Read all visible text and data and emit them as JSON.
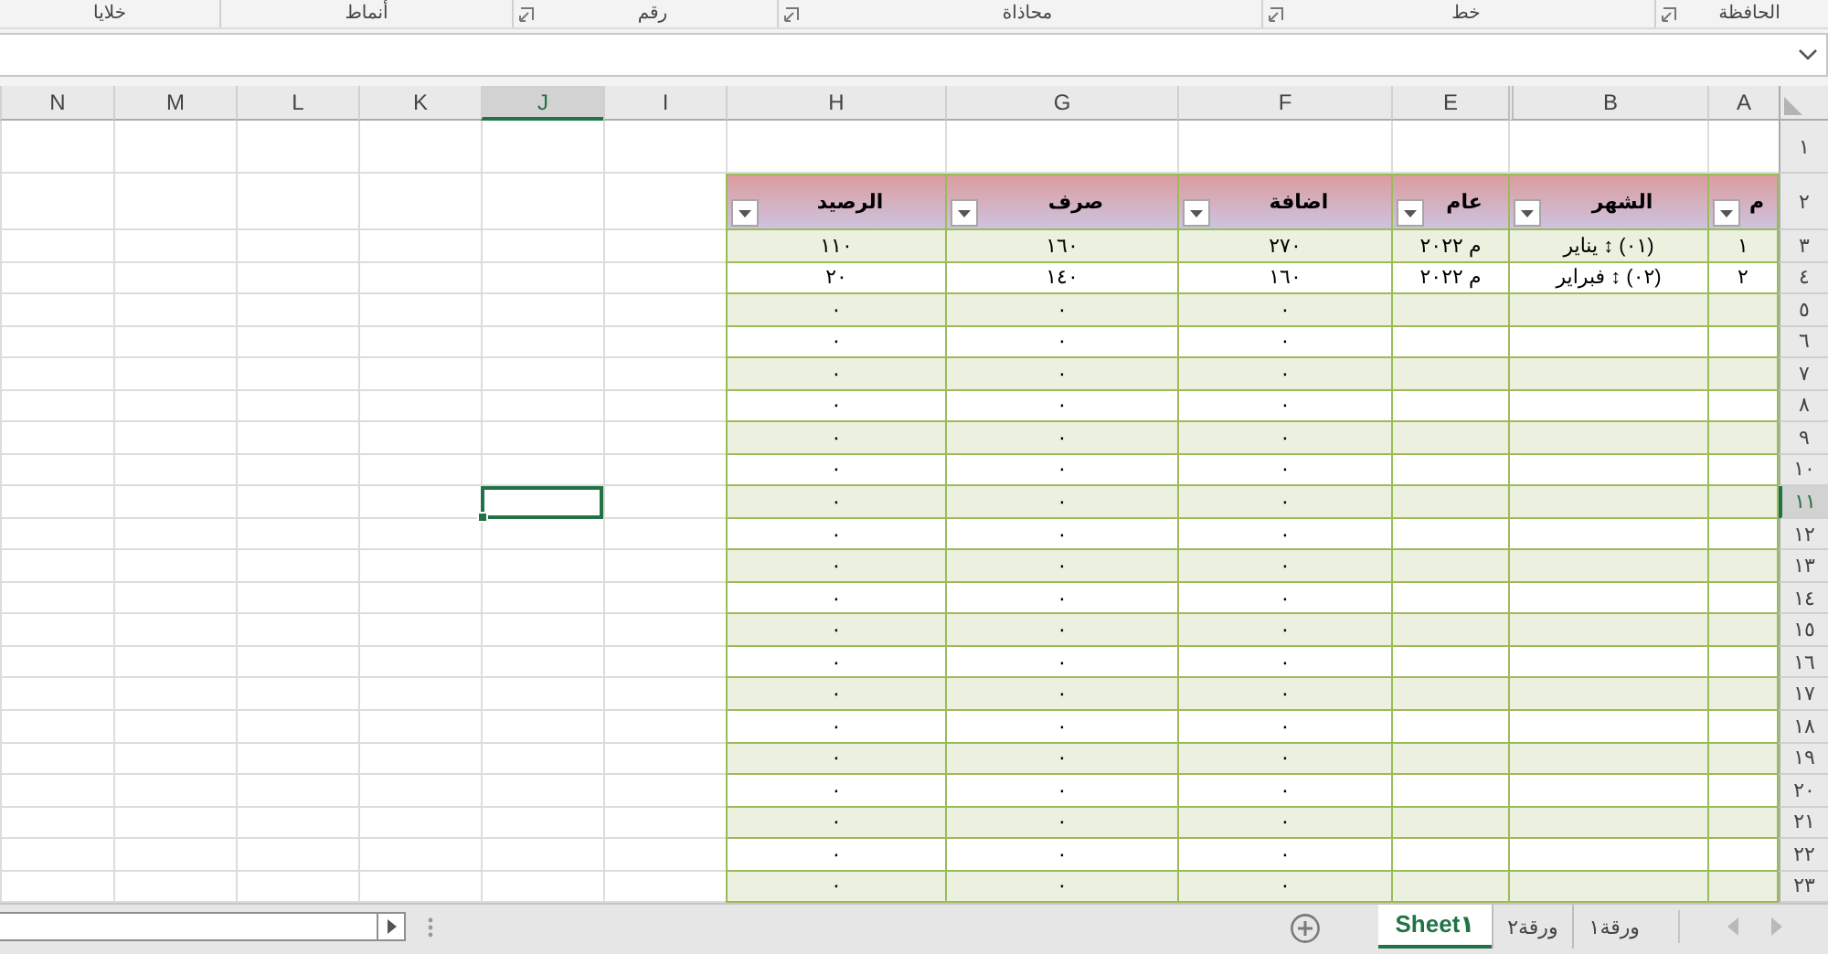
{
  "ribbon": {
    "groups": [
      {
        "label": "الحافظة",
        "launcher": true
      },
      {
        "label": "خط",
        "launcher": true
      },
      {
        "label": "محاذاة",
        "launcher": true
      },
      {
        "label": "رقم",
        "launcher": true
      },
      {
        "label": "أنماط",
        "launcher": false
      },
      {
        "label": "خلايا",
        "launcher": false
      }
    ]
  },
  "sheet": {
    "columns": [
      {
        "label": "A",
        "selected": false
      },
      {
        "label": "B",
        "selected": false
      },
      {
        "label": "E",
        "selected": false
      },
      {
        "label": "F",
        "selected": false
      },
      {
        "label": "G",
        "selected": false
      },
      {
        "label": "H",
        "selected": false
      },
      {
        "label": "I",
        "selected": false
      },
      {
        "label": "J",
        "selected": true
      },
      {
        "label": "K",
        "selected": false
      },
      {
        "label": "L",
        "selected": false
      },
      {
        "label": "M",
        "selected": false
      },
      {
        "label": "N",
        "selected": false
      }
    ],
    "rows": [
      {
        "label": "١",
        "selected": false
      },
      {
        "label": "٢",
        "selected": false
      },
      {
        "label": "٣",
        "selected": false
      },
      {
        "label": "٤",
        "selected": false
      },
      {
        "label": "٥",
        "selected": false
      },
      {
        "label": "٦",
        "selected": false
      },
      {
        "label": "٧",
        "selected": false
      },
      {
        "label": "٨",
        "selected": false
      },
      {
        "label": "٩",
        "selected": false
      },
      {
        "label": "١٠",
        "selected": false
      },
      {
        "label": "١١",
        "selected": true
      },
      {
        "label": "١٢",
        "selected": false
      },
      {
        "label": "١٣",
        "selected": false
      },
      {
        "label": "١٤",
        "selected": false
      },
      {
        "label": "١٥",
        "selected": false
      },
      {
        "label": "١٦",
        "selected": false
      },
      {
        "label": "١٧",
        "selected": false
      },
      {
        "label": "١٨",
        "selected": false
      },
      {
        "label": "١٩",
        "selected": false
      },
      {
        "label": "٢٠",
        "selected": false
      },
      {
        "label": "٢١",
        "selected": false
      },
      {
        "label": "٢٢",
        "selected": false
      },
      {
        "label": "٢٣",
        "selected": false
      }
    ]
  },
  "table": {
    "columns": [
      {
        "title": "م",
        "filter": true
      },
      {
        "title": "الشهر",
        "filter": true
      },
      {
        "title": "عام",
        "filter": true
      },
      {
        "title": "اضافة",
        "filter": true
      },
      {
        "title": "صرف",
        "filter": true
      },
      {
        "title": "الرصيد",
        "filter": true
      }
    ],
    "rows": [
      [
        "١",
        "(٠١) ↕ يناير",
        "م ٢٠٢٢",
        "٢٧٠",
        "١٦٠",
        "١١٠"
      ],
      [
        "٢",
        "(٠٢) ↕ فبراير",
        "م ٢٠٢٢",
        "١٦٠",
        "١٤٠",
        "٢٠"
      ],
      [
        null,
        null,
        null,
        "٠",
        "٠",
        "٠"
      ],
      [
        null,
        null,
        null,
        "٠",
        "٠",
        "٠"
      ],
      [
        null,
        null,
        null,
        "٠",
        "٠",
        "٠"
      ],
      [
        null,
        null,
        null,
        "٠",
        "٠",
        "٠"
      ],
      [
        null,
        null,
        null,
        "٠",
        "٠",
        "٠"
      ],
      [
        null,
        null,
        null,
        "٠",
        "٠",
        "٠"
      ],
      [
        null,
        null,
        null,
        "٠",
        "٠",
        "٠"
      ],
      [
        null,
        null,
        null,
        "٠",
        "٠",
        "٠"
      ],
      [
        null,
        null,
        null,
        "٠",
        "٠",
        "٠"
      ],
      [
        null,
        null,
        null,
        "٠",
        "٠",
        "٠"
      ],
      [
        null,
        null,
        null,
        "٠",
        "٠",
        "٠"
      ],
      [
        null,
        null,
        null,
        "٠",
        "٠",
        "٠"
      ],
      [
        null,
        null,
        null,
        "٠",
        "٠",
        "٠"
      ],
      [
        null,
        null,
        null,
        "٠",
        "٠",
        "٠"
      ],
      [
        null,
        null,
        null,
        "٠",
        "٠",
        "٠"
      ],
      [
        null,
        null,
        null,
        "٠",
        "٠",
        "٠"
      ],
      [
        null,
        null,
        null,
        "٠",
        "٠",
        "٠"
      ],
      [
        null,
        null,
        null,
        "٠",
        "٠",
        "٠"
      ],
      [
        null,
        null,
        null,
        "٠",
        "٠",
        "٠"
      ]
    ]
  },
  "sheet_tabs": {
    "navigation": [
      {
        "kind": "right",
        "disabled": true
      },
      {
        "kind": "left",
        "disabled": true
      }
    ],
    "tabs": [
      {
        "label": "ورقة١",
        "selected": false
      },
      {
        "label": "ورقة٢",
        "selected": false
      },
      {
        "label": "Sheet١",
        "selected": true
      }
    ]
  }
}
